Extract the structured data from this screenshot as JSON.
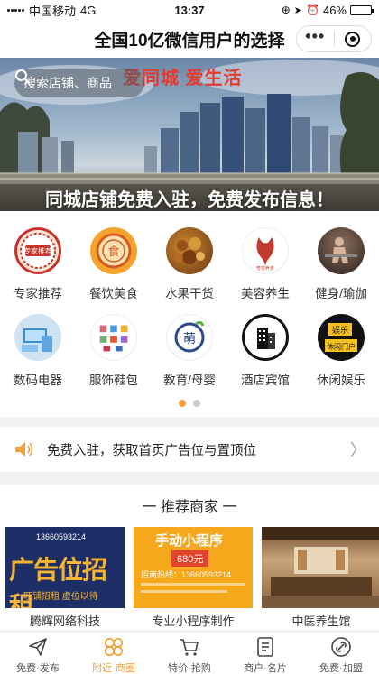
{
  "status_bar": {
    "carrier": "中国移动",
    "network": "4G",
    "time": "13:37",
    "battery_percent": "46%",
    "battery_level": 0.46
  },
  "nav": {
    "title": "全国10亿微信用户的选择",
    "more_icon": "more-dots-icon",
    "close_icon": "target-icon"
  },
  "banner": {
    "search_placeholder": "搜索店铺、商品",
    "slogan": "爱同城 爱生活",
    "caption": "同城店铺免费入驻，免费发布信息！",
    "page_index": 1,
    "page_count": 2
  },
  "categories": [
    {
      "label": "专家推荐",
      "icon": "expert-badge-icon",
      "color": "#c8342c"
    },
    {
      "label": "餐饮美食",
      "icon": "food-seal-icon",
      "color": "#e2572a"
    },
    {
      "label": "水果干货",
      "icon": "dried-goods-icon",
      "color": "#8a4a1c"
    },
    {
      "label": "美容养生",
      "icon": "beauty-logo-icon",
      "color": "#c33a2e"
    },
    {
      "label": "健身/瑜伽",
      "icon": "fitness-photo-icon",
      "color": "#553b2e"
    },
    {
      "label": "数码电器",
      "icon": "electronics-icon",
      "color": "#3b8fd6"
    },
    {
      "label": "服饰鞋包",
      "icon": "apparel-icon",
      "color": "#d66b7a"
    },
    {
      "label": "教育/母婴",
      "icon": "education-logo-icon",
      "color": "#2d4a8a"
    },
    {
      "label": "酒店宾馆",
      "icon": "hotel-building-icon",
      "color": "#111111"
    },
    {
      "label": "休闲娱乐",
      "icon": "entertainment-sign-icon",
      "color": "#f3c020"
    }
  ],
  "notice": {
    "text": "免费入驻，获取首页广告位与置顶位",
    "icon": "speaker-icon"
  },
  "recommend": {
    "title": "一 推荐商家 一",
    "items": [
      {
        "name": "腾辉网络科技",
        "ad_headline": "广告位招租",
        "ad_sub": "旺铺招租 虚位以待",
        "phone": "13660593214"
      },
      {
        "name": "专业小程序制作",
        "ad_headline": "手动小程序",
        "price": "680元",
        "ad_sub": "招商热线：13660593214"
      },
      {
        "name": "中医养生馆",
        "ad_headline": "",
        "ad_sub": ""
      }
    ]
  },
  "tabbar": [
    {
      "label": "免费·发布",
      "icon": "paper-plane-icon",
      "active": false
    },
    {
      "label": "附近·商圈",
      "icon": "clover-grid-icon",
      "active": true
    },
    {
      "label": "特价·抢购",
      "icon": "shopping-cart-icon",
      "active": false
    },
    {
      "label": "商户·名片",
      "icon": "business-card-icon",
      "active": false
    },
    {
      "label": "免费·加盟",
      "icon": "join-link-icon",
      "active": false
    }
  ],
  "colors": {
    "accent": "#f0a038",
    "slogan_red": "#e63a2e"
  }
}
